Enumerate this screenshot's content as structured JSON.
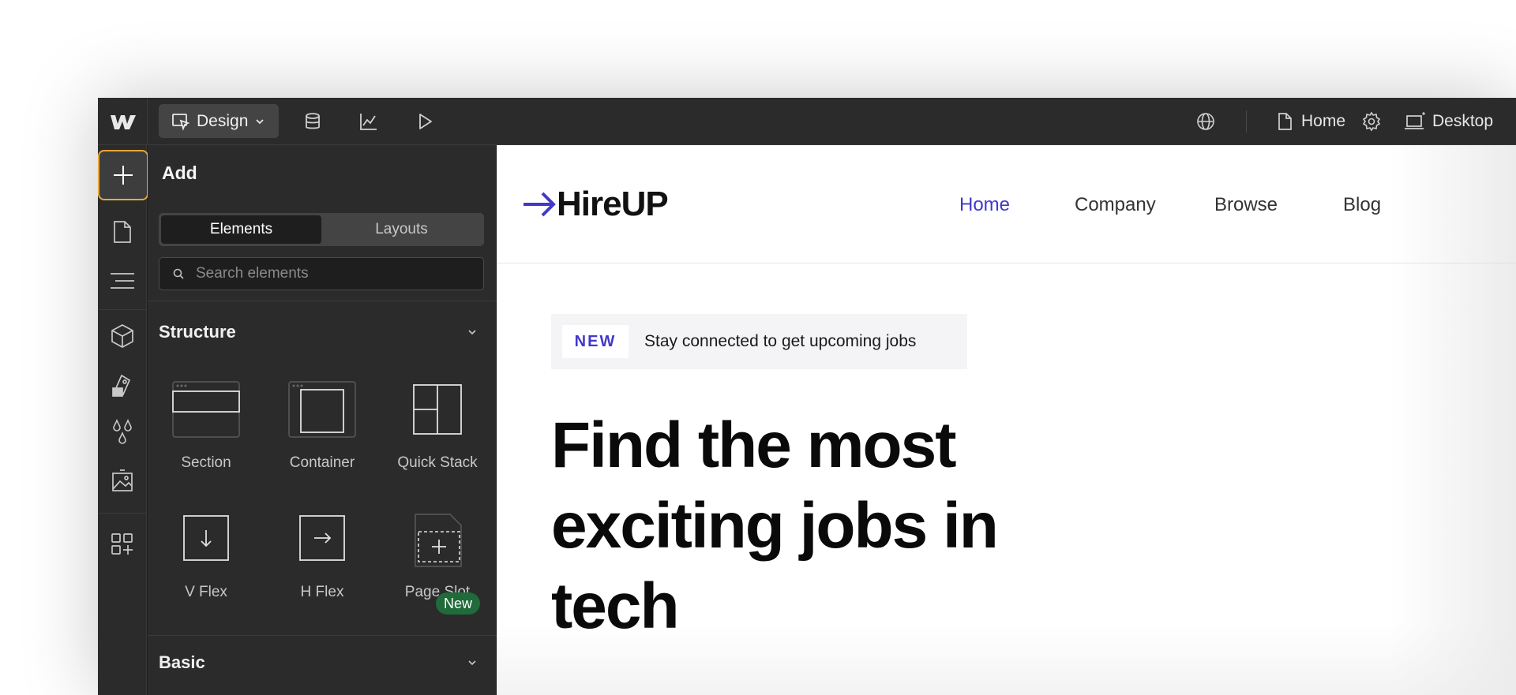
{
  "topbar": {
    "mode_label": "Design",
    "page_label": "Home",
    "breakpoint_label": "Desktop",
    "icons": [
      "webflow-logo",
      "design-mode-icon",
      "chevron-down-icon",
      "database-icon",
      "analytics-icon",
      "play-icon",
      "globe-icon",
      "page-icon",
      "settings-gear-icon",
      "desktop-breakpoint-icon"
    ]
  },
  "rail": {
    "icons": [
      "plus-icon",
      "page-icon",
      "navigator-icon",
      "cube-icon",
      "style-icon",
      "drops-icon",
      "image-icon",
      "apps-icon"
    ],
    "active_color": "#e8a838"
  },
  "panel": {
    "title": "Add",
    "tabs": [
      "Elements",
      "Layouts"
    ],
    "search_placeholder": "Search elements",
    "sections": [
      {
        "title": "Structure",
        "items": [
          {
            "label": "Section"
          },
          {
            "label": "Container"
          },
          {
            "label": "Quick Stack"
          },
          {
            "label": "V Flex"
          },
          {
            "label": "H Flex"
          },
          {
            "label": "Page Slot",
            "badge": "New"
          }
        ]
      },
      {
        "title": "Basic"
      }
    ]
  },
  "canvas": {
    "brand": "HireUP",
    "nav": [
      "Home",
      "Company",
      "Browse",
      "Blog"
    ],
    "announce_tag": "NEW",
    "announce_text": "Stay connected to get upcoming jobs",
    "hero_lines": [
      "Find the most",
      "exciting jobs in",
      "tech"
    ],
    "accent_color": "#4338ca"
  }
}
